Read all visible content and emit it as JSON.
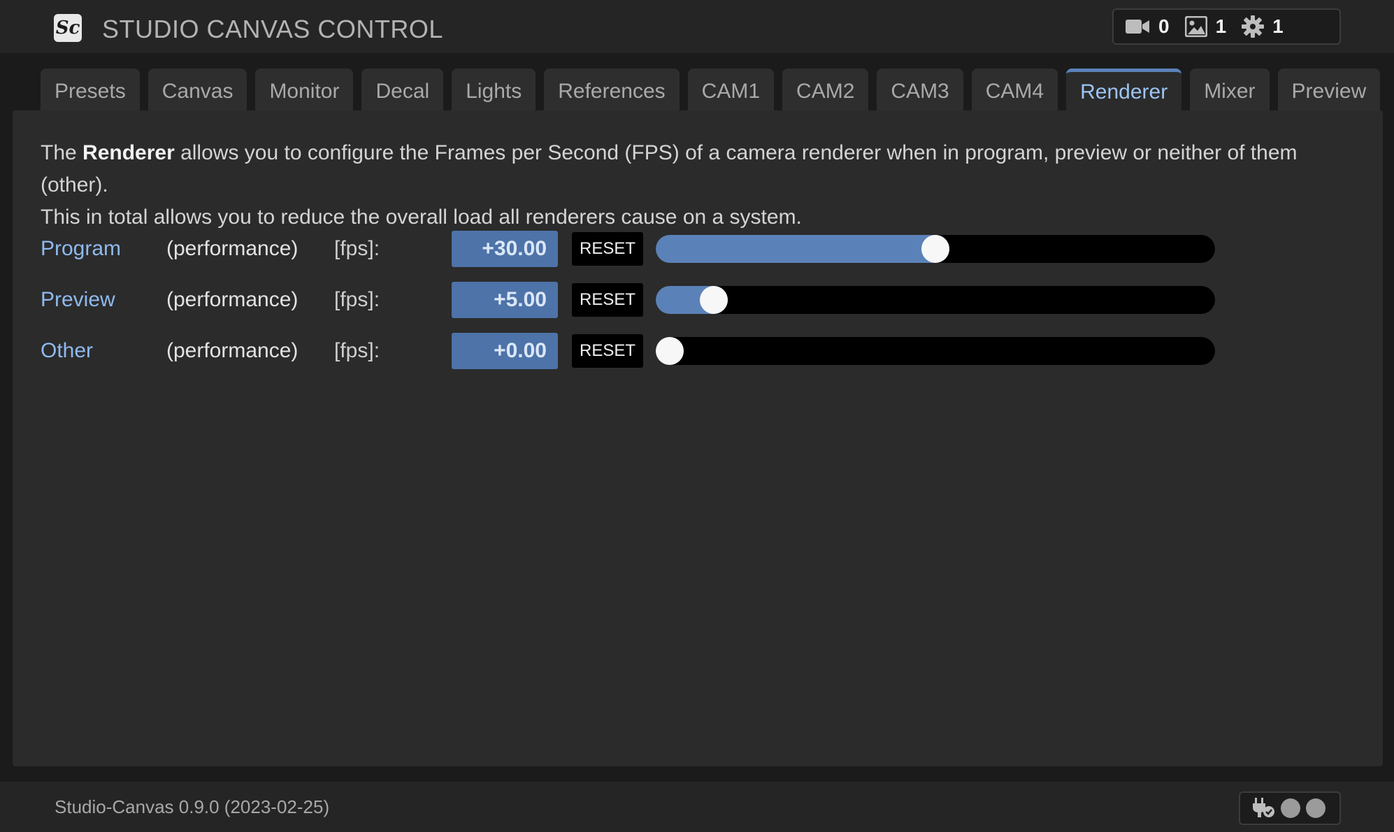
{
  "header": {
    "logo_text": "Sc",
    "title": "STUDIO CANVAS CONTROL",
    "stats": [
      {
        "icon": "video-camera-icon",
        "value": "0"
      },
      {
        "icon": "image-icon",
        "value": "1"
      },
      {
        "icon": "gear-icon",
        "value": "1"
      }
    ]
  },
  "tabs": [
    {
      "label": "Presets",
      "active": false
    },
    {
      "label": "Canvas",
      "active": false
    },
    {
      "label": "Monitor",
      "active": false
    },
    {
      "label": "Decal",
      "active": false
    },
    {
      "label": "Lights",
      "active": false
    },
    {
      "label": "References",
      "active": false
    },
    {
      "label": "CAM1",
      "active": false
    },
    {
      "label": "CAM2",
      "active": false
    },
    {
      "label": "CAM3",
      "active": false
    },
    {
      "label": "CAM4",
      "active": false
    },
    {
      "label": "Renderer",
      "active": true
    },
    {
      "label": "Mixer",
      "active": false
    },
    {
      "label": "Preview",
      "active": false
    }
  ],
  "description": {
    "prefix": "The ",
    "strong": "Renderer",
    "line1_rest": " allows you to configure the Frames per Second (FPS) of a camera renderer when in program, preview or neither of them (other).",
    "line2": "This in total allows you to reduce the overall load all renderers cause on a system."
  },
  "rows": [
    {
      "label": "Program",
      "mode": "(performance)",
      "unit": "[fps]:",
      "value": "+30.00",
      "reset_label": "RESET",
      "fraction": 0.5
    },
    {
      "label": "Preview",
      "mode": "(performance)",
      "unit": "[fps]:",
      "value": "+5.00",
      "reset_label": "RESET",
      "fraction": 0.0833
    },
    {
      "label": "Other",
      "mode": "(performance)",
      "unit": "[fps]:",
      "value": "+0.00",
      "reset_label": "RESET",
      "fraction": 0.0
    }
  ],
  "footer": {
    "version": "Studio-Canvas 0.9.0 (2023-02-25)",
    "status_icon": "plug-check-icon",
    "indicators": 2
  },
  "colors": {
    "accent": "#5b82b8",
    "label": "#8fbaf0",
    "active_tab_text": "#9cc4f5"
  }
}
